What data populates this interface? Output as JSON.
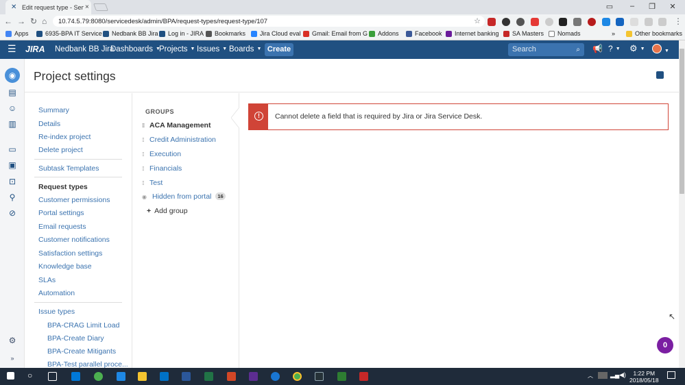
{
  "browser": {
    "tab_title": "Edit request type - Service",
    "url": "10.74.5.79:8080/servicedesk/admin/BPA/request-types/request-type/107"
  },
  "bookmarks": [
    {
      "label": "Apps",
      "color": "#4285f4"
    },
    {
      "label": "6935-BPA IT Service",
      "color": "#205081"
    },
    {
      "label": "Nedbank BB Jira",
      "color": "#205081"
    },
    {
      "label": "Log in - JIRA",
      "color": "#205081"
    },
    {
      "label": "Bookmarks",
      "color": "#555555"
    },
    {
      "label": "Jira Cloud eval",
      "color": "#2684ff"
    },
    {
      "label": "Gmail: Email from G",
      "color": "#d93025"
    },
    {
      "label": "Addons",
      "color": "#3a9f3a"
    },
    {
      "label": "Facebook",
      "color": "#3b5998"
    },
    {
      "label": "Internet banking",
      "color": "#6a1b9a"
    },
    {
      "label": "SA Masters",
      "color": "#c62828"
    },
    {
      "label": "Nomads",
      "color": "#555555"
    },
    {
      "label": "Other bookmarks",
      "color": "#f4c430"
    }
  ],
  "header": {
    "logo": "JIRA",
    "site": "Nedbank BB Jira",
    "nav": [
      "Dashboards",
      "Projects",
      "Issues",
      "Boards"
    ],
    "create_label": "Create",
    "search_placeholder": "Search"
  },
  "page": {
    "title": "Project settings"
  },
  "settings_nav": {
    "group1": [
      "Summary",
      "Details",
      "Re-index project",
      "Delete project"
    ],
    "group2": [
      "Subtask Templates"
    ],
    "group3_title": "Request types",
    "group3": [
      "Customer permissions",
      "Portal settings",
      "Email requests",
      "Customer notifications",
      "Satisfaction settings",
      "Knowledge base",
      "SLAs",
      "Automation"
    ],
    "issue_types_title": "Issue types",
    "issue_types": [
      "BPA-CRAG Limit Load",
      "BPA-Create Diary",
      "BPA-Create Mitigants",
      "BPA-Test parallel proce..."
    ]
  },
  "groups": {
    "label": "GROUPS",
    "items": [
      "ACA Management",
      "Credit Administration",
      "Execution",
      "Financials",
      "Test"
    ],
    "hidden_label": "Hidden from portal",
    "hidden_count": "16",
    "add_label": "Add group"
  },
  "error": {
    "message": "Cannot delete a field that is required by Jira or Jira Service Desk."
  },
  "help": {
    "count": "0"
  },
  "taskbar": {
    "time": "1:22 PM",
    "date": "2018/05/18"
  },
  "colors": {
    "header": "#205081",
    "error": "#d04437",
    "link": "#3b73af"
  }
}
